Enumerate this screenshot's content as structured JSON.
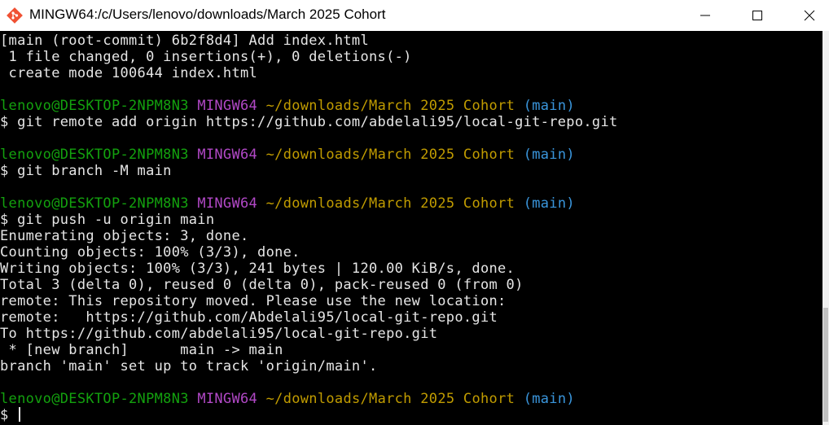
{
  "window": {
    "title": "MINGW64:/c/Users/lenovo/downloads/March 2025 Cohort",
    "app_icon": "git-icon",
    "controls": [
      "minimize-icon",
      "maximize-icon",
      "close-icon"
    ]
  },
  "colors": {
    "background": "#000000",
    "text": "#e6e6e6",
    "user": "#13a10e",
    "shell": "#b148c6",
    "path": "#c19c00",
    "branch": "#3a96dd",
    "git_icon": "#f05133"
  },
  "prompt": {
    "user_host": "lenovo@DESKTOP-2NPM8N3",
    "shell": "MINGW64",
    "path": "~/downloads/March 2025 Cohort",
    "branch": "(main)",
    "symbol": "$"
  },
  "lines": [
    {
      "text": "[main (root-commit) 6b2f8d4] Add index.html"
    },
    {
      "text": " 1 file changed, 0 insertions(+), 0 deletions(-)"
    },
    {
      "text": " create mode 100644 index.html"
    },
    {
      "text": ""
    },
    {
      "prompt": true
    },
    {
      "text": "$ git remote add origin https://github.com/abdelali95/local-git-repo.git"
    },
    {
      "text": ""
    },
    {
      "prompt": true
    },
    {
      "text": "$ git branch -M main"
    },
    {
      "text": ""
    },
    {
      "prompt": true
    },
    {
      "text": "$ git push -u origin main"
    },
    {
      "text": "Enumerating objects: 3, done."
    },
    {
      "text": "Counting objects: 100% (3/3), done."
    },
    {
      "text": "Writing objects: 100% (3/3), 241 bytes | 120.00 KiB/s, done."
    },
    {
      "text": "Total 3 (delta 0), reused 0 (delta 0), pack-reused 0 (from 0)"
    },
    {
      "text": "remote: This repository moved. Please use the new location:"
    },
    {
      "text": "remote:   https://github.com/Abdelali95/local-git-repo.git"
    },
    {
      "text": "To https://github.com/abdelali95/local-git-repo.git"
    },
    {
      "text": " * [new branch]      main -> main"
    },
    {
      "text": "branch 'main' set up to track 'origin/main'."
    },
    {
      "text": ""
    },
    {
      "prompt": true
    },
    {
      "text": "$ ",
      "cursor": true
    }
  ]
}
